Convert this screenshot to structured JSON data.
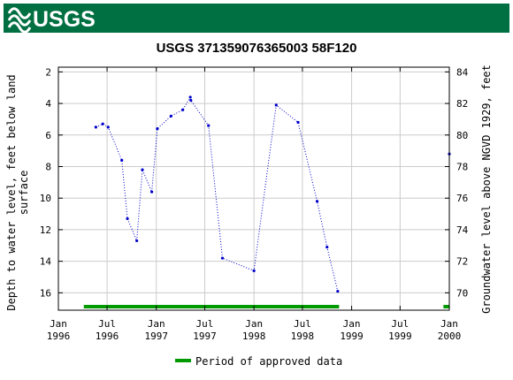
{
  "header": {
    "logo_text": "USGS",
    "brand_color": "#006f41"
  },
  "chart_data": {
    "type": "scatter",
    "title": "USGS 371359076365003 58F120",
    "ylabel_left": [
      "Depth to water level, feet below land",
      "surface"
    ],
    "ylabel_right": "Groundwater level above NGVD 1929, feet",
    "x_ticks": [
      {
        "date": "1996-01-01",
        "line1": "Jan",
        "line2": "1996"
      },
      {
        "date": "1996-07-01",
        "line1": "Jul",
        "line2": "1996"
      },
      {
        "date": "1997-01-01",
        "line1": "Jan",
        "line2": "1997"
      },
      {
        "date": "1997-07-01",
        "line1": "Jul",
        "line2": "1997"
      },
      {
        "date": "1998-01-01",
        "line1": "Jan",
        "line2": "1998"
      },
      {
        "date": "1998-07-01",
        "line1": "Jul",
        "line2": "1998"
      },
      {
        "date": "1999-01-01",
        "line1": "Jan",
        "line2": "1999"
      },
      {
        "date": "1999-07-01",
        "line1": "Jul",
        "line2": "1999"
      },
      {
        "date": "2000-01-01",
        "line1": "Jan",
        "line2": "2000"
      }
    ],
    "xlim": [
      "1996-01-01",
      "2000-01-01"
    ],
    "ylim_left": [
      17.1,
      1.7
    ],
    "yticks_left": [
      2,
      4,
      6,
      8,
      10,
      12,
      14,
      16
    ],
    "yticks_right": [
      70,
      72,
      74,
      76,
      78,
      80,
      82,
      84
    ],
    "right_axis_offset": 86,
    "grid": true,
    "series": [
      {
        "points": [
          [
            "1996-05-20",
            5.5
          ],
          [
            "1996-06-15",
            5.3
          ],
          [
            "1996-07-05",
            5.5
          ],
          [
            "1996-08-25",
            7.6
          ],
          [
            "1996-09-15",
            11.3
          ],
          [
            "1996-10-20",
            12.7
          ],
          [
            "1996-11-10",
            8.2
          ],
          [
            "1996-12-15",
            9.6
          ],
          [
            "1997-01-05",
            5.6
          ],
          [
            "1997-02-25",
            4.8
          ],
          [
            "1997-04-10",
            4.4
          ],
          [
            "1997-05-08",
            3.6
          ],
          [
            "1997-05-10",
            3.8
          ],
          [
            "1997-07-15",
            5.4
          ],
          [
            "1997-09-05",
            13.8
          ],
          [
            "1998-01-01",
            14.6
          ],
          [
            "1998-03-25",
            4.1
          ],
          [
            "1998-06-15",
            5.2
          ],
          [
            "1998-08-25",
            10.2
          ],
          [
            "1998-10-01",
            13.1
          ],
          [
            "1998-11-10",
            15.9
          ]
        ],
        "color": "#0000cc",
        "style": "dotted"
      },
      {
        "points": [
          [
            "2000-01-01",
            7.2
          ]
        ],
        "color": "#0000cc",
        "style": "point"
      }
    ],
    "approved_periods": [
      [
        "1996-04-05",
        "1998-11-15"
      ],
      [
        "1999-12-10",
        "1999-12-31"
      ]
    ],
    "approved_color": "#009900",
    "legend": {
      "label": "Period of approved data",
      "position": "bottom-center"
    }
  }
}
